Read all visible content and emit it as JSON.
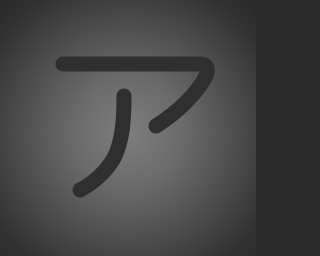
{
  "icon": {
    "name": "katakana-a-icon",
    "glyph": "ア",
    "stroke_color": "#2f2f2f",
    "background_center_color": "#7e7e7e",
    "background_edge_color": "#292929"
  }
}
